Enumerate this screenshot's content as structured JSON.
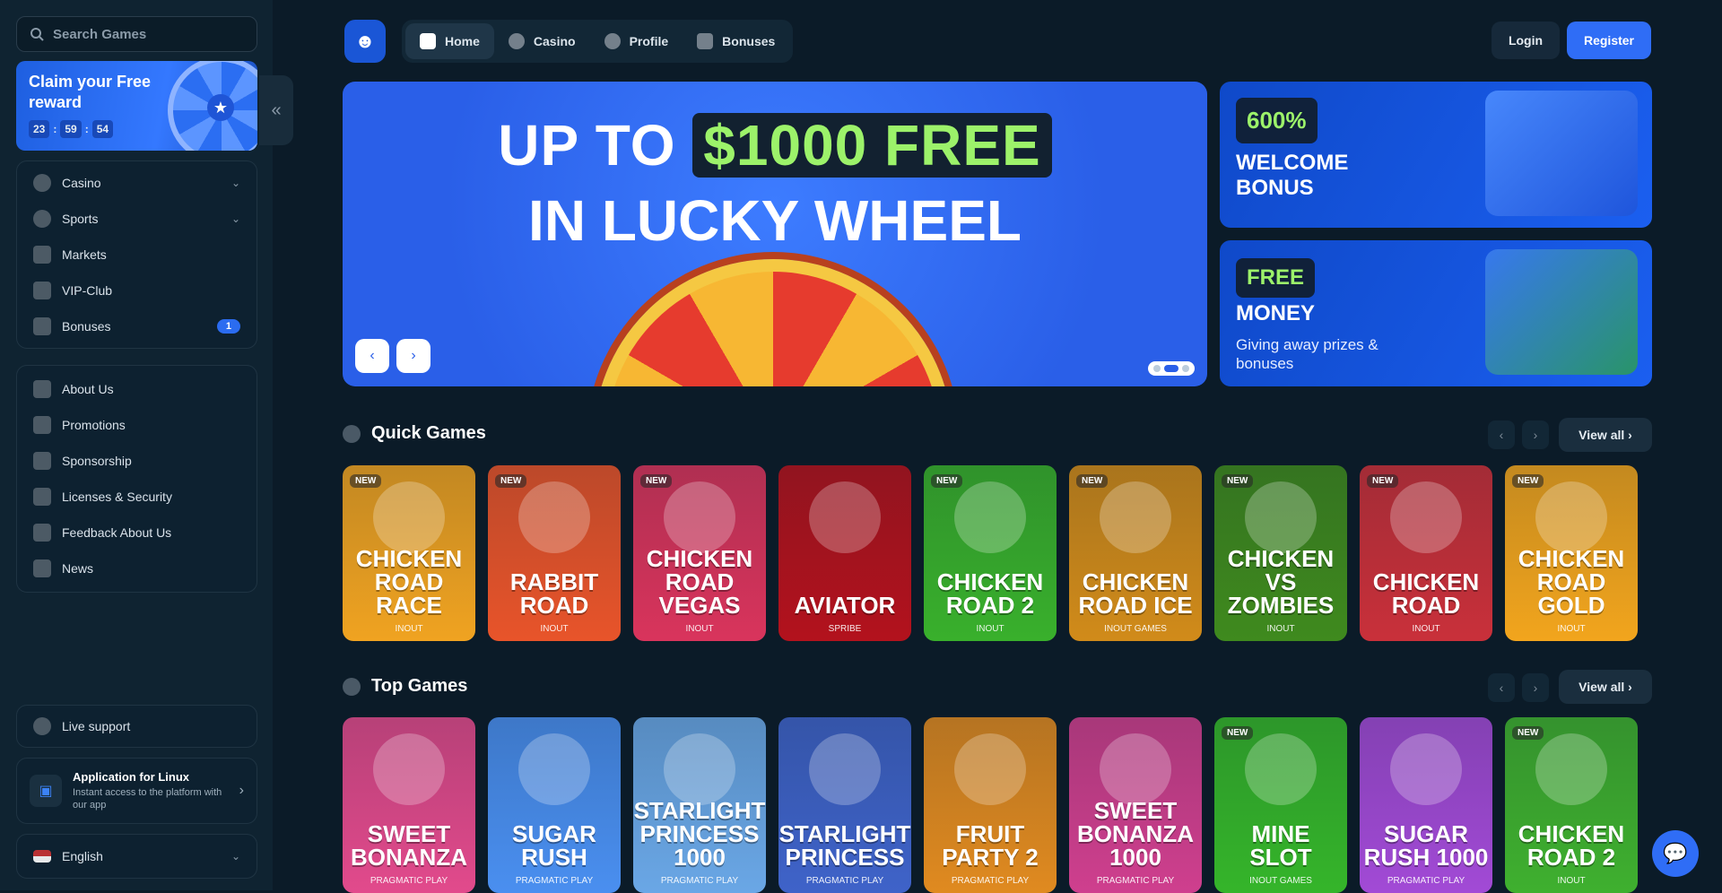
{
  "search": {
    "placeholder": "Search Games"
  },
  "reward": {
    "title": "Claim your Free reward",
    "timer": [
      "23",
      "59",
      "54"
    ]
  },
  "menu": [
    {
      "label": "Casino",
      "icon": "casino-icon",
      "expandable": true
    },
    {
      "label": "Sports",
      "icon": "globe-icon",
      "expandable": true
    },
    {
      "label": "Markets",
      "icon": "chart-icon"
    },
    {
      "label": "VIP-Club",
      "icon": "crown-icon"
    },
    {
      "label": "Bonuses",
      "icon": "gift-icon",
      "badge": "1"
    }
  ],
  "info_menu": [
    {
      "label": "About Us"
    },
    {
      "label": "Promotions"
    },
    {
      "label": "Sponsorship"
    },
    {
      "label": "Licenses & Security"
    },
    {
      "label": "Feedback About Us"
    },
    {
      "label": "News"
    }
  ],
  "support": {
    "label": "Live support"
  },
  "app": {
    "title": "Application for Linux",
    "subtitle": "Instant access to the platform with our app"
  },
  "language": {
    "label": "English"
  },
  "nav": {
    "tabs": [
      "Home",
      "Casino",
      "Profile",
      "Bonuses"
    ],
    "login": "Login",
    "register": "Register"
  },
  "hero": {
    "line1a": "UP TO",
    "line1b": "$1000 FREE",
    "line2": "IN LUCKY WHEEL"
  },
  "promo1": {
    "pill": "600%",
    "title": "WELCOME BONUS"
  },
  "promo2": {
    "pill": "FREE",
    "title": "MONEY",
    "subtitle": "Giving away prizes & bonuses"
  },
  "quick": {
    "title": "Quick Games",
    "view_all": "View all",
    "games": [
      {
        "name": "CHICKEN ROAD RACE",
        "provider": "INOUT",
        "new": "NEW",
        "color": "#f0a321"
      },
      {
        "name": "RABBIT ROAD",
        "provider": "INOUT",
        "new": "NEW",
        "color": "#e8542a"
      },
      {
        "name": "CHICKEN ROAD VEGAS",
        "provider": "INOUT",
        "new": "NEW",
        "color": "#d9345c"
      },
      {
        "name": "AVIATOR",
        "provider": "SPRIBE",
        "new": "",
        "color": "#b3121d"
      },
      {
        "name": "CHICKEN ROAD 2",
        "provider": "INOUT",
        "new": "NEW",
        "color": "#39b02c"
      },
      {
        "name": "CHICKEN ROAD ICE",
        "provider": "INOUT GAMES",
        "new": "NEW",
        "color": "#d18b1a"
      },
      {
        "name": "CHICKEN VS ZOMBIES",
        "provider": "INOUT",
        "new": "NEW",
        "color": "#3f8a1e"
      },
      {
        "name": "CHICKEN ROAD",
        "provider": "INOUT",
        "new": "NEW",
        "color": "#c9303a"
      },
      {
        "name": "CHICKEN ROAD GOLD",
        "provider": "INOUT",
        "new": "NEW",
        "color": "#f2a51d"
      }
    ]
  },
  "top": {
    "title": "Top Games",
    "view_all": "View all",
    "games": [
      {
        "name": "SWEET BONANZA",
        "provider": "PRAGMATIC PLAY",
        "new": "",
        "color": "#e24a8c"
      },
      {
        "name": "SUGAR RUSH",
        "provider": "PRAGMATIC PLAY",
        "new": "",
        "color": "#4a8ff0"
      },
      {
        "name": "STARLIGHT PRINCESS 1000",
        "provider": "PRAGMATIC PLAY",
        "new": "",
        "color": "#6aa7e6"
      },
      {
        "name": "STARLIGHT PRINCESS",
        "provider": "PRAGMATIC PLAY",
        "new": "",
        "color": "#3f63c9"
      },
      {
        "name": "FRUIT PARTY 2",
        "provider": "PRAGMATIC PLAY",
        "new": "",
        "color": "#e08a20"
      },
      {
        "name": "SWEET BONANZA 1000",
        "provider": "PRAGMATIC PLAY",
        "new": "",
        "color": "#cf3f8e"
      },
      {
        "name": "MINE SLOT",
        "provider": "INOUT GAMES",
        "new": "NEW",
        "color": "#35b52a"
      },
      {
        "name": "SUGAR RUSH 1000",
        "provider": "PRAGMATIC PLAY",
        "new": "",
        "color": "#a24ad6"
      },
      {
        "name": "CHICKEN ROAD 2",
        "provider": "INOUT",
        "new": "NEW",
        "color": "#3fb02f"
      }
    ]
  }
}
